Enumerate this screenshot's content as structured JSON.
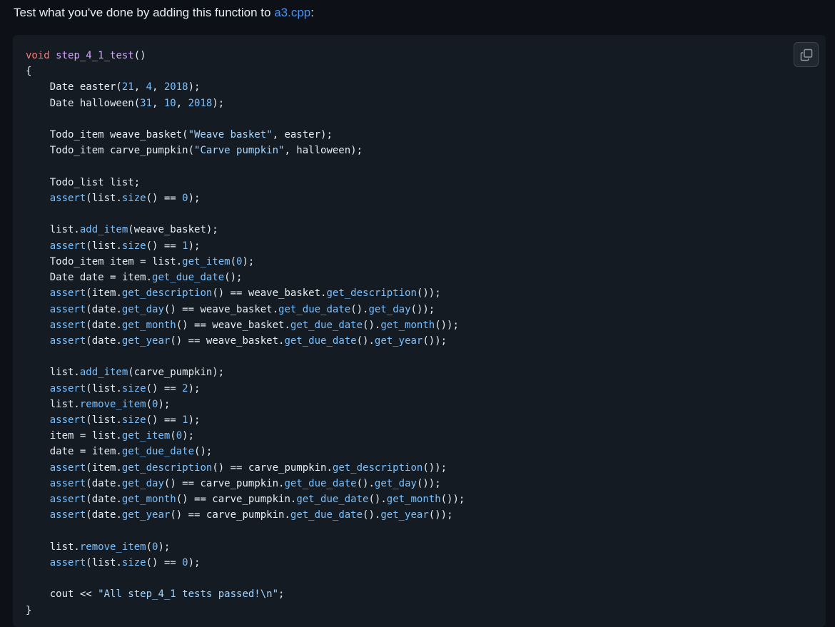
{
  "intro": {
    "text_before": "Test what you've done by adding this function to ",
    "link_text": "a3.cpp",
    "text_after": ":"
  },
  "copy_button": {
    "icon": "copy-icon"
  },
  "colors": {
    "page_background": "#0d1117",
    "code_background": "#151b23",
    "link": "#4493f8",
    "keyword": "#ff7b72",
    "function_name": "#d2a8ff",
    "number": "#79c0ff",
    "string": "#a5d6ff",
    "method_call": "#79c0ff",
    "text": "#e6edf3"
  },
  "code": {
    "language": "cpp",
    "lines": [
      [
        [
          "kw",
          "void"
        ],
        [
          "t",
          " "
        ],
        [
          "fn",
          "step_4_1_test"
        ],
        [
          "t",
          "()"
        ]
      ],
      [
        [
          "t",
          "{"
        ]
      ],
      [
        [
          "t",
          "    Date easter("
        ],
        [
          "num",
          "21"
        ],
        [
          "t",
          ", "
        ],
        [
          "num",
          "4"
        ],
        [
          "t",
          ", "
        ],
        [
          "num",
          "2018"
        ],
        [
          "t",
          ");"
        ]
      ],
      [
        [
          "t",
          "    Date halloween("
        ],
        [
          "num",
          "31"
        ],
        [
          "t",
          ", "
        ],
        [
          "num",
          "10"
        ],
        [
          "t",
          ", "
        ],
        [
          "num",
          "2018"
        ],
        [
          "t",
          ");"
        ]
      ],
      [],
      [
        [
          "t",
          "    Todo_item weave_basket("
        ],
        [
          "str",
          "\"Weave basket\""
        ],
        [
          "t",
          ", easter);"
        ]
      ],
      [
        [
          "t",
          "    Todo_item carve_pumpkin("
        ],
        [
          "str",
          "\"Carve pumpkin\""
        ],
        [
          "t",
          ", halloween);"
        ]
      ],
      [],
      [
        [
          "t",
          "    Todo_list list;"
        ]
      ],
      [
        [
          "t",
          "    "
        ],
        [
          "call",
          "assert"
        ],
        [
          "t",
          "(list."
        ],
        [
          "call",
          "size"
        ],
        [
          "t",
          "() == "
        ],
        [
          "num",
          "0"
        ],
        [
          "t",
          ");"
        ]
      ],
      [],
      [
        [
          "t",
          "    list."
        ],
        [
          "call",
          "add_item"
        ],
        [
          "t",
          "(weave_basket);"
        ]
      ],
      [
        [
          "t",
          "    "
        ],
        [
          "call",
          "assert"
        ],
        [
          "t",
          "(list."
        ],
        [
          "call",
          "size"
        ],
        [
          "t",
          "() == "
        ],
        [
          "num",
          "1"
        ],
        [
          "t",
          ");"
        ]
      ],
      [
        [
          "t",
          "    Todo_item item = list."
        ],
        [
          "call",
          "get_item"
        ],
        [
          "t",
          "("
        ],
        [
          "num",
          "0"
        ],
        [
          "t",
          ");"
        ]
      ],
      [
        [
          "t",
          "    Date date = item."
        ],
        [
          "call",
          "get_due_date"
        ],
        [
          "t",
          "();"
        ]
      ],
      [
        [
          "t",
          "    "
        ],
        [
          "call",
          "assert"
        ],
        [
          "t",
          "(item."
        ],
        [
          "call",
          "get_description"
        ],
        [
          "t",
          "() == weave_basket."
        ],
        [
          "call",
          "get_description"
        ],
        [
          "t",
          "());"
        ]
      ],
      [
        [
          "t",
          "    "
        ],
        [
          "call",
          "assert"
        ],
        [
          "t",
          "(date."
        ],
        [
          "call",
          "get_day"
        ],
        [
          "t",
          "() == weave_basket."
        ],
        [
          "call",
          "get_due_date"
        ],
        [
          "t",
          "()."
        ],
        [
          "call",
          "get_day"
        ],
        [
          "t",
          "());"
        ]
      ],
      [
        [
          "t",
          "    "
        ],
        [
          "call",
          "assert"
        ],
        [
          "t",
          "(date."
        ],
        [
          "call",
          "get_month"
        ],
        [
          "t",
          "() == weave_basket."
        ],
        [
          "call",
          "get_due_date"
        ],
        [
          "t",
          "()."
        ],
        [
          "call",
          "get_month"
        ],
        [
          "t",
          "());"
        ]
      ],
      [
        [
          "t",
          "    "
        ],
        [
          "call",
          "assert"
        ],
        [
          "t",
          "(date."
        ],
        [
          "call",
          "get_year"
        ],
        [
          "t",
          "() == weave_basket."
        ],
        [
          "call",
          "get_due_date"
        ],
        [
          "t",
          "()."
        ],
        [
          "call",
          "get_year"
        ],
        [
          "t",
          "());"
        ]
      ],
      [],
      [
        [
          "t",
          "    list."
        ],
        [
          "call",
          "add_item"
        ],
        [
          "t",
          "(carve_pumpkin);"
        ]
      ],
      [
        [
          "t",
          "    "
        ],
        [
          "call",
          "assert"
        ],
        [
          "t",
          "(list."
        ],
        [
          "call",
          "size"
        ],
        [
          "t",
          "() == "
        ],
        [
          "num",
          "2"
        ],
        [
          "t",
          ");"
        ]
      ],
      [
        [
          "t",
          "    list."
        ],
        [
          "call",
          "remove_item"
        ],
        [
          "t",
          "("
        ],
        [
          "num",
          "0"
        ],
        [
          "t",
          ");"
        ]
      ],
      [
        [
          "t",
          "    "
        ],
        [
          "call",
          "assert"
        ],
        [
          "t",
          "(list."
        ],
        [
          "call",
          "size"
        ],
        [
          "t",
          "() == "
        ],
        [
          "num",
          "1"
        ],
        [
          "t",
          ");"
        ]
      ],
      [
        [
          "t",
          "    item = list."
        ],
        [
          "call",
          "get_item"
        ],
        [
          "t",
          "("
        ],
        [
          "num",
          "0"
        ],
        [
          "t",
          ");"
        ]
      ],
      [
        [
          "t",
          "    date = item."
        ],
        [
          "call",
          "get_due_date"
        ],
        [
          "t",
          "();"
        ]
      ],
      [
        [
          "t",
          "    "
        ],
        [
          "call",
          "assert"
        ],
        [
          "t",
          "(item."
        ],
        [
          "call",
          "get_description"
        ],
        [
          "t",
          "() == carve_pumpkin."
        ],
        [
          "call",
          "get_description"
        ],
        [
          "t",
          "());"
        ]
      ],
      [
        [
          "t",
          "    "
        ],
        [
          "call",
          "assert"
        ],
        [
          "t",
          "(date."
        ],
        [
          "call",
          "get_day"
        ],
        [
          "t",
          "() == carve_pumpkin."
        ],
        [
          "call",
          "get_due_date"
        ],
        [
          "t",
          "()."
        ],
        [
          "call",
          "get_day"
        ],
        [
          "t",
          "());"
        ]
      ],
      [
        [
          "t",
          "    "
        ],
        [
          "call",
          "assert"
        ],
        [
          "t",
          "(date."
        ],
        [
          "call",
          "get_month"
        ],
        [
          "t",
          "() == carve_pumpkin."
        ],
        [
          "call",
          "get_due_date"
        ],
        [
          "t",
          "()."
        ],
        [
          "call",
          "get_month"
        ],
        [
          "t",
          "());"
        ]
      ],
      [
        [
          "t",
          "    "
        ],
        [
          "call",
          "assert"
        ],
        [
          "t",
          "(date."
        ],
        [
          "call",
          "get_year"
        ],
        [
          "t",
          "() == carve_pumpkin."
        ],
        [
          "call",
          "get_due_date"
        ],
        [
          "t",
          "()."
        ],
        [
          "call",
          "get_year"
        ],
        [
          "t",
          "());"
        ]
      ],
      [],
      [
        [
          "t",
          "    list."
        ],
        [
          "call",
          "remove_item"
        ],
        [
          "t",
          "("
        ],
        [
          "num",
          "0"
        ],
        [
          "t",
          ");"
        ]
      ],
      [
        [
          "t",
          "    "
        ],
        [
          "call",
          "assert"
        ],
        [
          "t",
          "(list."
        ],
        [
          "call",
          "size"
        ],
        [
          "t",
          "() == "
        ],
        [
          "num",
          "0"
        ],
        [
          "t",
          ");"
        ]
      ],
      [],
      [
        [
          "t",
          "    cout << "
        ],
        [
          "str",
          "\"All step_4_1 tests passed!\\n\""
        ],
        [
          "t",
          ";"
        ]
      ],
      [
        [
          "t",
          "}"
        ]
      ]
    ]
  }
}
